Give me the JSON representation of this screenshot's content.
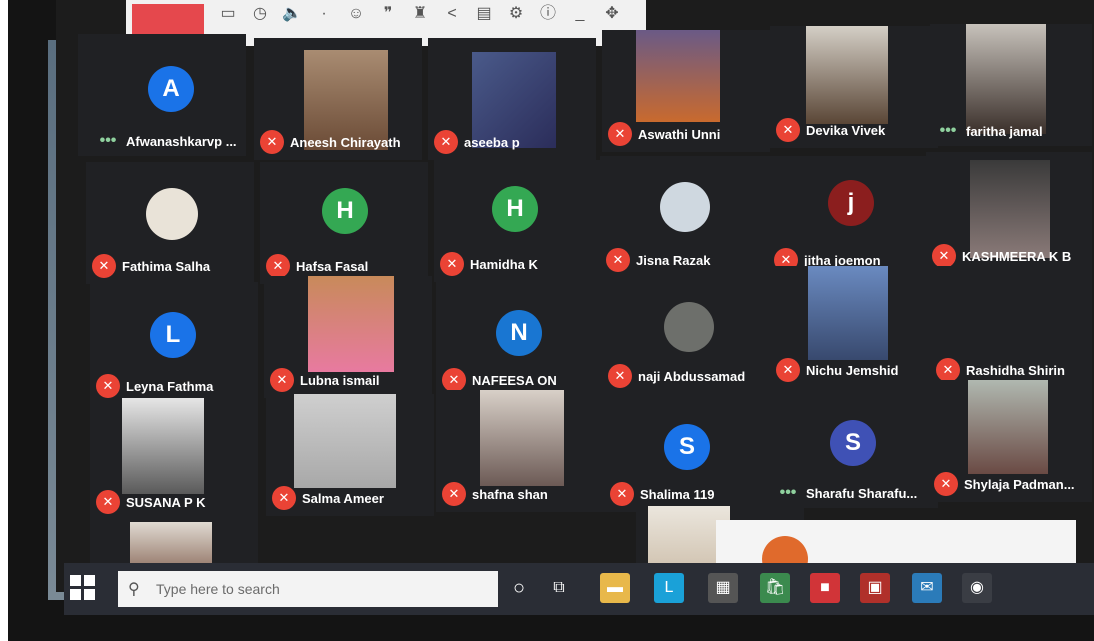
{
  "toolbar": {
    "icons": [
      "window-icon",
      "clock-icon",
      "speaker-icon",
      "dot-icon",
      "emoji-icon",
      "quote-icon",
      "badge-icon",
      "share-icon",
      "chart-icon",
      "settings-icon",
      "info-icon",
      "minimize-icon",
      "move-icon"
    ]
  },
  "participants": [
    {
      "name": "Afwanashkarvp ...",
      "avatar": "A",
      "color": "#1a73e8",
      "muted": false
    },
    {
      "name": "Aneesh Chirayath",
      "avatar": "",
      "color": "",
      "muted": true
    },
    {
      "name": "aseeba p",
      "avatar": "",
      "color": "",
      "muted": true
    },
    {
      "name": "Aswathi Unni",
      "avatar": "",
      "color": "",
      "muted": true
    },
    {
      "name": "Devika Vivek",
      "avatar": "",
      "color": "",
      "muted": true
    },
    {
      "name": "faritha jamal",
      "avatar": "",
      "color": "",
      "muted": false
    },
    {
      "name": "Fathima Salha",
      "avatar": "",
      "color": "",
      "muted": true
    },
    {
      "name": "Hafsa Fasal",
      "avatar": "H",
      "color": "#34a853",
      "muted": true
    },
    {
      "name": "Hamidha K",
      "avatar": "H",
      "color": "#34a853",
      "muted": true
    },
    {
      "name": "Jisna Razak",
      "avatar": "",
      "color": "",
      "muted": true
    },
    {
      "name": "jitha joemon",
      "avatar": "j",
      "color": "#8b1e1e",
      "muted": true
    },
    {
      "name": "KASHMEERA K B",
      "avatar": "",
      "color": "",
      "muted": true
    },
    {
      "name": "Leyna Fathma",
      "avatar": "L",
      "color": "#1a73e8",
      "muted": true
    },
    {
      "name": "Lubna ismail",
      "avatar": "",
      "color": "",
      "muted": true
    },
    {
      "name": "NAFEESA ON",
      "avatar": "N",
      "color": "#1976d2",
      "muted": true
    },
    {
      "name": "naji Abdussamad",
      "avatar": "",
      "color": "",
      "muted": true
    },
    {
      "name": "Nichu Jemshid",
      "avatar": "",
      "color": "",
      "muted": true
    },
    {
      "name": "Rashidha Shirin",
      "avatar": "",
      "color": "",
      "muted": true
    },
    {
      "name": "SUSANA P K",
      "avatar": "",
      "color": "",
      "muted": true
    },
    {
      "name": "Salma Ameer",
      "avatar": "",
      "color": "",
      "muted": true
    },
    {
      "name": "shafna shan",
      "avatar": "",
      "color": "",
      "muted": true
    },
    {
      "name": "Shalima 119",
      "avatar": "S",
      "color": "#1a73e8",
      "muted": true
    },
    {
      "name": "Sharafu Sharafu...",
      "avatar": "S",
      "color": "#3f51b5",
      "muted": false
    },
    {
      "name": "Shylaja Padman...",
      "avatar": "",
      "color": "",
      "muted": true
    }
  ],
  "taskbar": {
    "search_placeholder": "Type here to search"
  }
}
